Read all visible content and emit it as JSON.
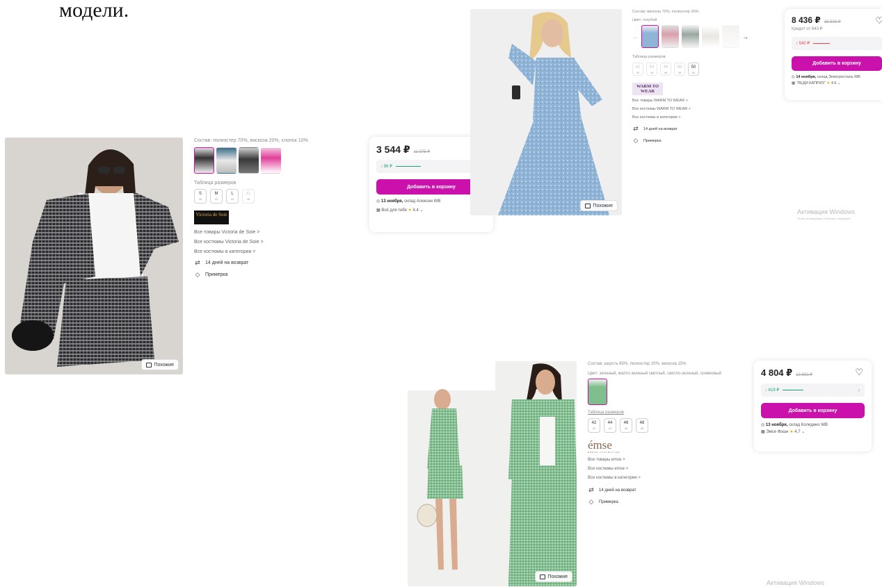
{
  "heading": "модели.",
  "listings": [
    {
      "composition": "Состав: полиэстер 70%, вискоза 20%, хлопок 10%",
      "size_table_label": "Таблица размеров",
      "sizes": [
        {
          "size": "S",
          "ru": "40"
        },
        {
          "size": "M",
          "ru": "42"
        },
        {
          "size": "L",
          "ru": "44"
        },
        {
          "size": "XL",
          "ru": "46"
        }
      ],
      "brand": "Victoria de Soie",
      "links": [
        "Все товары Victoria de Soie >",
        "Все костюмы Victoria de Soie >",
        "Все костюмы в категории >"
      ],
      "features": [
        "14 дней на возврат",
        "Примерка"
      ],
      "similar_label": "Похожие",
      "price": "3 544 ₽",
      "old_price": "11 375 ₽",
      "price_drop": "↓ 96 ₽",
      "cart_label": "Добавить в корзину",
      "delivery_date": "13 ноября,",
      "delivery_place": "склад Алексин WB",
      "seller": "Всё для тебя",
      "rating": "4.4"
    },
    {
      "composition": "Состав: вискоза 70%, полиэстер 30%",
      "color": "Цвет: голубой",
      "size_table_label": "Таблица размеров",
      "sizes": [
        {
          "size": "42",
          "ru": "42"
        },
        {
          "size": "44",
          "ru": "44"
        },
        {
          "size": "46",
          "ru": "46"
        },
        {
          "size": "48",
          "ru": "48"
        },
        {
          "size": "50",
          "ru": "50"
        }
      ],
      "brand": "WARM TO WEAR",
      "links": [
        "Все товары WARM TO WEAR >",
        "Все костюмы WARM TO WEAR >",
        "Все костюмы в категории >"
      ],
      "features": [
        "14 дней на возврат",
        "Примерка"
      ],
      "similar_label": "Похожие",
      "price": "8 436 ₽",
      "old_price": "16 500 ₽",
      "credit": "Кредит от 843 ₽",
      "price_change": "↑ 540 ₽",
      "cart_label": "Добавить в корзину",
      "delivery_date": "14 ноября,",
      "delivery_place": "склад Электросталь WB",
      "seller": "\"ЛЕДИ КАПРИЗ\"",
      "rating": "4.5"
    },
    {
      "composition": "Состав: шерсть 65%, полиэстер 20%, вискоза 15%",
      "color": "Цвет: зеленый, желто-зеленый светлый, светло-зеленый, оливковый",
      "size_table_label": "Таблица размеров",
      "sizes": [
        {
          "size": "42",
          "ru": "42"
        },
        {
          "size": "44",
          "ru": "44"
        },
        {
          "size": "46",
          "ru": "46"
        },
        {
          "size": "48",
          "ru": "48"
        }
      ],
      "brand": "émse",
      "brand_sub": "DRESS COLLECTION",
      "links": [
        "Все товары emse >",
        "Все костюмы emse >",
        "Все костюмы в категории >"
      ],
      "features": [
        "14 дней на возврат",
        "Примерка"
      ],
      "similar_label": "Похожие",
      "price": "4 804 ₽",
      "old_price": "10 900 ₽",
      "price_drop": "↓ 619 ₽",
      "cart_label": "Добавить в корзину",
      "delivery_date": "13 ноября,",
      "delivery_place": "склад Коледино WB",
      "seller": "Эмсе Фэшн",
      "rating": "4.7"
    }
  ],
  "watermark": {
    "title": "Активация Windows",
    "subtitle": "Чтобы активировать Windows, перейдите"
  },
  "colors": {
    "accent": "#cb11ab",
    "price_down": "#1aa36f",
    "price_up": "#e8444a"
  }
}
